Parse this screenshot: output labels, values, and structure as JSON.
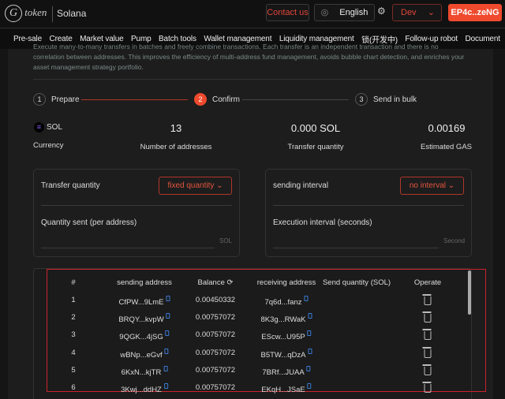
{
  "header": {
    "logo_text": "token",
    "chain": "Solana",
    "contact": "Contact us",
    "language": "English",
    "env": "Dev",
    "wallet": "EP4c..zeNG"
  },
  "nav": [
    "Pre-sale",
    "Create",
    "Market value",
    "Pump",
    "Batch tools",
    "Wallet management",
    "Liquidity management",
    "锁(开发中)",
    "Follow-up robot",
    "Document"
  ],
  "description": "Execute many-to-many transfers in batches and freely combine transactions. Each transfer is an independent transaction and there is no correlation between addresses. This improves the efficiency of multi-address fund management, avoids bubble chart detection, and enriches your asset management strategy portfolio.",
  "steps": [
    {
      "n": "1",
      "label": "Prepare"
    },
    {
      "n": "2",
      "label": "Confirm"
    },
    {
      "n": "3",
      "label": "Send in bulk"
    }
  ],
  "stats": {
    "currency": "SOL",
    "currency_label": "Currency",
    "addresses": "13",
    "addresses_label": "Number of addresses",
    "quantity": "0.000 SOL",
    "quantity_label": "Transfer quantity",
    "gas": "0.00169",
    "gas_label": "Estimated GAS"
  },
  "left_panel": {
    "title": "Transfer quantity",
    "select": "fixed quantity",
    "field_label": "Quantity sent (per address)",
    "unit": "SOL"
  },
  "right_panel": {
    "title": "sending interval",
    "select": "no interval",
    "field_label": "Execution interval (seconds)",
    "unit": "Second"
  },
  "table": {
    "headers": [
      "#",
      "sending address",
      "Balance",
      "receiving address",
      "Send quantity (SOL)",
      "Operate"
    ],
    "rows": [
      [
        "1",
        "CfPW...9LmE",
        "0.00450332",
        "7q6d...fanz"
      ],
      [
        "2",
        "BRQY...kvpW",
        "0.00757072",
        "8K3g...RWaK"
      ],
      [
        "3",
        "9QGK...4jSG",
        "0.00757072",
        "EScw...U95P"
      ],
      [
        "4",
        "wBNp...eGvf",
        "0.00757072",
        "B5TW...qDzA"
      ],
      [
        "5",
        "6KxN...kjTR",
        "0.00757072",
        "7BRf...JUAA"
      ],
      [
        "6",
        "3Kwj...ddHZ",
        "0.00757072",
        "EKqH...JSaE"
      ]
    ]
  }
}
